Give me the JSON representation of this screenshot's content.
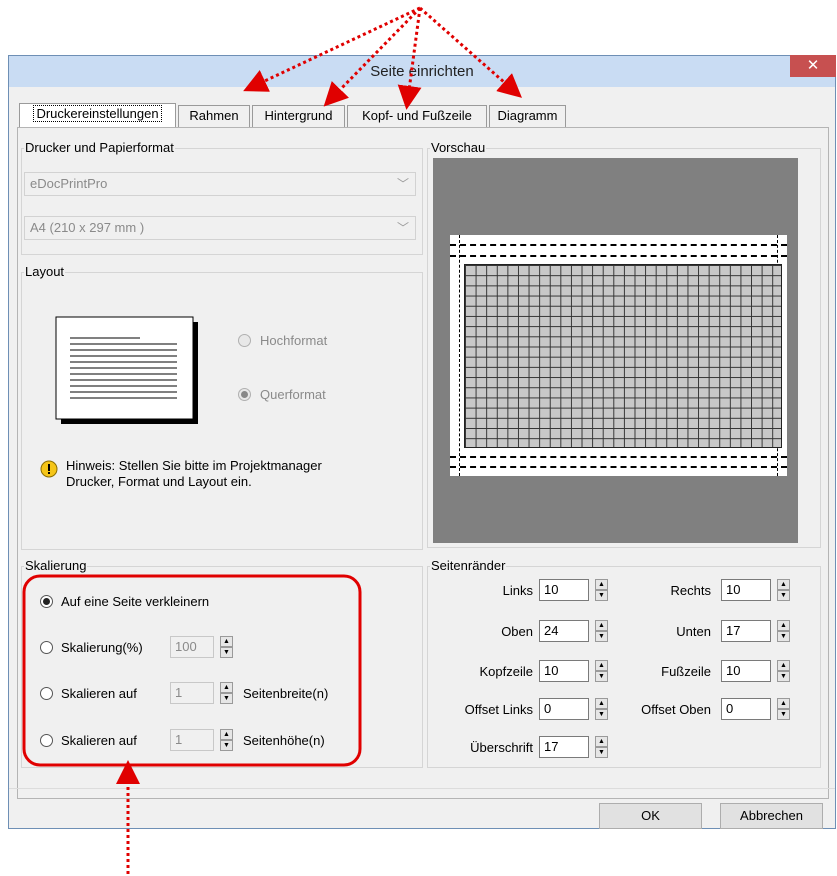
{
  "window": {
    "title": "Seite einrichten"
  },
  "tabs": [
    {
      "label": "Druckereinstellungen"
    },
    {
      "label": "Rahmen"
    },
    {
      "label": "Hintergrund"
    },
    {
      "label": "Kopf- und Fußzeile"
    },
    {
      "label": "Diagramm"
    }
  ],
  "printer_group": {
    "label": "Drucker und Papierformat",
    "printer": "eDocPrintPro",
    "paper": "A4 (210 x 297 mm )"
  },
  "layout_group": {
    "label": "Layout",
    "portrait": "Hochformat",
    "landscape": "Querformat",
    "selected": "landscape",
    "hint": "Hinweis: Stellen Sie bitte im Projektmanager Drucker, Format und Layout ein."
  },
  "preview_group": {
    "label": "Vorschau"
  },
  "scaling_group": {
    "label": "Skalierung",
    "fit_page": "Auf eine Seite verkleinern",
    "scale_percent": "Skalierung(%)",
    "scale_percent_value": "100",
    "scale_to_1": "Skalieren auf",
    "scale_to_1_value": "1",
    "scale_to_1_unit": "Seitenbreite(n)",
    "scale_to_2": "Skalieren auf",
    "scale_to_2_value": "1",
    "scale_to_2_unit": "Seitenhöhe(n)",
    "selected": "fit_page"
  },
  "margins_group": {
    "label": "Seitenränder",
    "left_label": "Links",
    "left": "10",
    "right_label": "Rechts",
    "right": "10",
    "top_label": "Oben",
    "top": "24",
    "bottom_label": "Unten",
    "bottom": "17",
    "header_label": "Kopfzeile",
    "header": "10",
    "footer_label": "Fußzeile",
    "footer": "10",
    "offset_left_label": "Offset Links",
    "offset_left": "0",
    "offset_top_label": "Offset Oben",
    "offset_top": "0",
    "caption_label": "Überschrift",
    "caption": "17"
  },
  "buttons": {
    "ok": "OK",
    "cancel": "Abbrechen"
  },
  "colors": {
    "annotation": "#e00000",
    "close": "#c75050"
  }
}
